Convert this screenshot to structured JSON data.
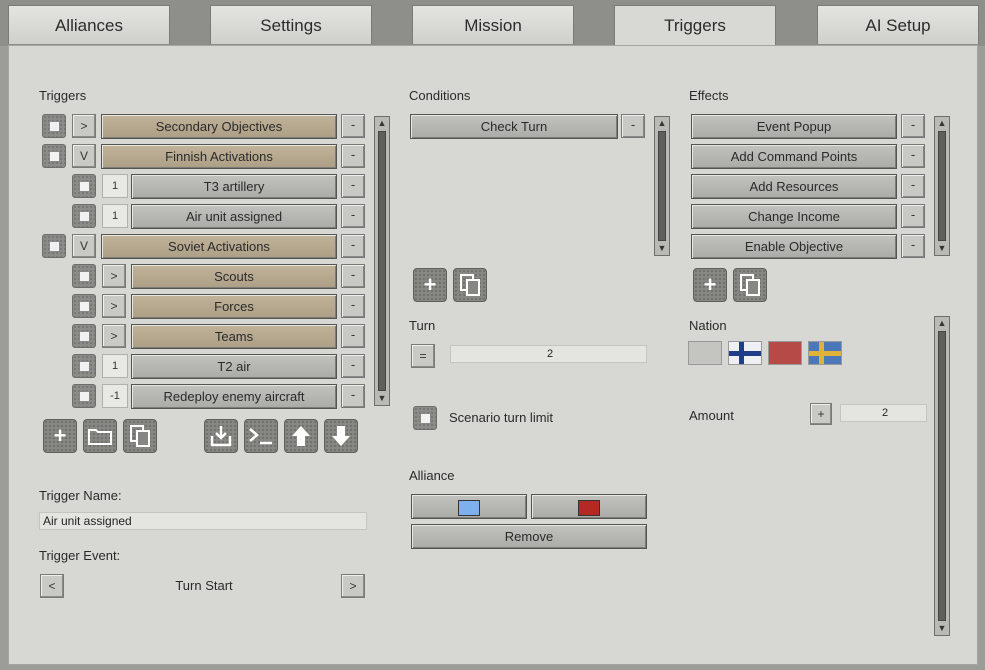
{
  "tabs": [
    {
      "label": "Alliances",
      "active": false
    },
    {
      "label": "Settings",
      "active": false
    },
    {
      "label": "Mission",
      "active": false
    },
    {
      "label": "Triggers",
      "active": true
    },
    {
      "label": "AI Setup",
      "active": false
    }
  ],
  "triggers": {
    "heading": "Triggers",
    "items": [
      {
        "indent": 0,
        "toggle": ">",
        "label": "Secondary Objectives",
        "style": "tan"
      },
      {
        "indent": 0,
        "toggle": "V",
        "label": "Finnish Activations",
        "style": "tan"
      },
      {
        "indent": 1,
        "toggle": "1",
        "label": "T3 artillery",
        "style": "grey"
      },
      {
        "indent": 1,
        "toggle": "1",
        "label": "Air unit assigned",
        "style": "grey"
      },
      {
        "indent": 0,
        "toggle": "V",
        "label": "Soviet Activations",
        "style": "tan"
      },
      {
        "indent": 1,
        "toggle": ">",
        "label": "Scouts",
        "style": "tan"
      },
      {
        "indent": 1,
        "toggle": ">",
        "label": "Forces",
        "style": "tan"
      },
      {
        "indent": 1,
        "toggle": ">",
        "label": "Teams",
        "style": "tan"
      },
      {
        "indent": 1,
        "toggle": "1",
        "label": "T2 air",
        "style": "grey"
      },
      {
        "indent": 1,
        "toggle": "-1",
        "label": "Redeploy enemy aircraft",
        "style": "grey"
      }
    ],
    "remove_label": "-",
    "toolbar_icons": [
      "add-icon",
      "folder-icon",
      "copy-icon",
      "import-icon",
      "console-icon",
      "arrow-up-icon",
      "arrow-down-icon"
    ],
    "name_label": "Trigger Name:",
    "name_value": "Air unit assigned",
    "event_label": "Trigger Event:",
    "event_value": "Turn Start",
    "prev": "<",
    "next": ">"
  },
  "conditions": {
    "heading": "Conditions",
    "items": [
      "Check Turn"
    ],
    "turn_label": "Turn",
    "turn_operator": "=",
    "turn_value": "2",
    "scenario_limit_label": "Scenario turn limit",
    "alliance_label": "Alliance",
    "alliance_colors": [
      "#7fb0ee",
      "#b22a22"
    ],
    "remove_button": "Remove"
  },
  "effects": {
    "heading": "Effects",
    "items": [
      "Event Popup",
      "Add Command Points",
      "Add Resources",
      "Change Income",
      "Enable Objective"
    ],
    "nation_label": "Nation",
    "amount_label": "Amount",
    "amount_operator": "+",
    "amount_value": "2"
  }
}
